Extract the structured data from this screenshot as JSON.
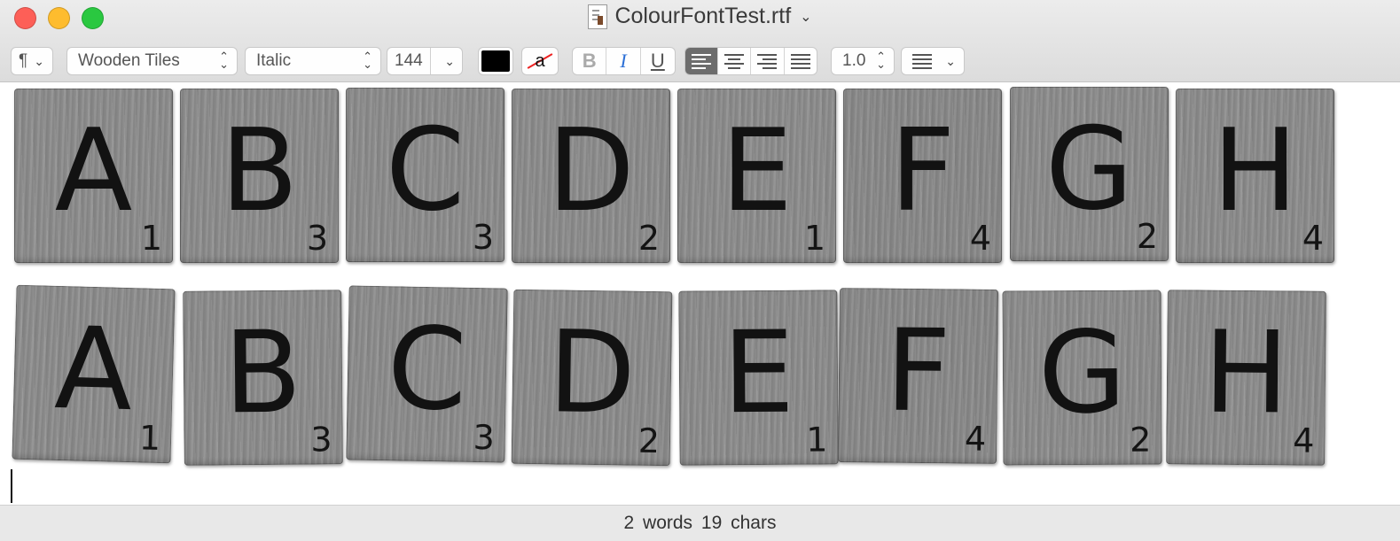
{
  "window": {
    "title": "ColourFontTest.rtf",
    "title_chevron": "⌄"
  },
  "toolbar": {
    "paragraph_style": "¶",
    "font_family": "Wooden Tiles",
    "font_style": "Italic",
    "font_size": "144",
    "text_color": "#000000",
    "highlight_glyph": "a",
    "bold_label": "B",
    "italic_label": "I",
    "underline_label": "U",
    "alignment_selected": "left",
    "line_spacing": "1.0"
  },
  "document": {
    "rows": [
      {
        "tiles": [
          {
            "letter": "A",
            "score": "1"
          },
          {
            "letter": "B",
            "score": "3"
          },
          {
            "letter": "C",
            "score": "3"
          },
          {
            "letter": "D",
            "score": "2"
          },
          {
            "letter": "E",
            "score": "1"
          },
          {
            "letter": "F",
            "score": "4"
          },
          {
            "letter": "G",
            "score": "2"
          },
          {
            "letter": "H",
            "score": "4"
          }
        ]
      },
      {
        "tiles": [
          {
            "letter": "A",
            "score": "1"
          },
          {
            "letter": "B",
            "score": "3"
          },
          {
            "letter": "C",
            "score": "3"
          },
          {
            "letter": "D",
            "score": "2"
          },
          {
            "letter": "E",
            "score": "1"
          },
          {
            "letter": "F",
            "score": "4"
          },
          {
            "letter": "G",
            "score": "2"
          },
          {
            "letter": "H",
            "score": "4"
          }
        ]
      }
    ]
  },
  "status": {
    "text": "2 words 19 chars"
  },
  "colors": {
    "close": "#fd5f57",
    "minimize": "#febc2e",
    "zoom": "#2ac840",
    "tile_wood": "#8d8d8d",
    "selected_segment": "#6d6d6d"
  }
}
